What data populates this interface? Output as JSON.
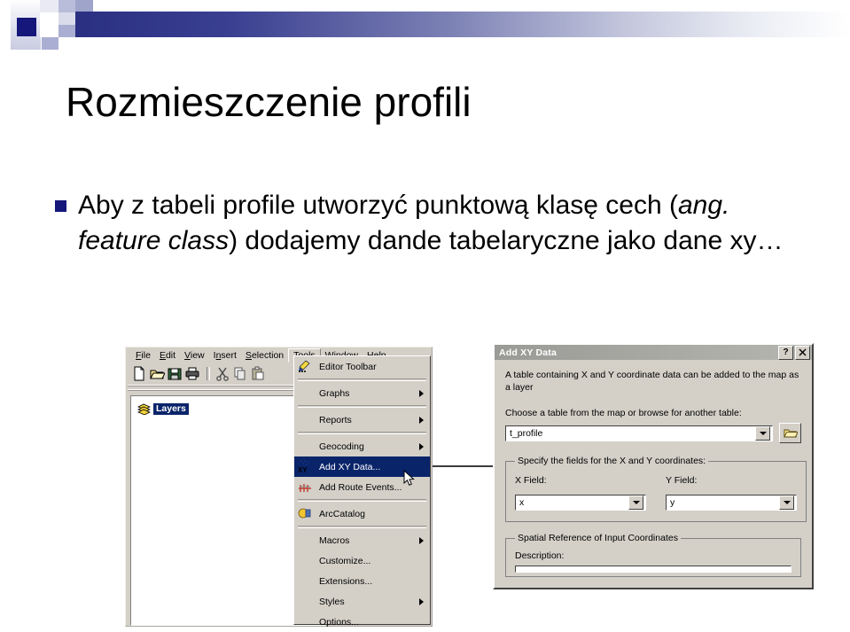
{
  "slide": {
    "title": "Rozmieszczenie profili",
    "bullet": {
      "marker": "square-bullet",
      "line1_a": "Aby z tabeli profile utworzyć punktową klasę cech (",
      "line1_italic": "ang. feature class",
      "line1_b": ") dodajemy dande tabelaryczne jako dane xy…"
    }
  },
  "arcmap": {
    "menubar": [
      {
        "label": "File",
        "accel": "F"
      },
      {
        "label": "Edit",
        "accel": "E"
      },
      {
        "label": "View",
        "accel": "V"
      },
      {
        "label": "Insert",
        "accel": "I"
      },
      {
        "label": "Selection",
        "accel": "S"
      },
      {
        "label": "Tools",
        "accel": "T"
      },
      {
        "label": "Window",
        "accel": "W"
      },
      {
        "label": "Help",
        "accel": "H"
      }
    ],
    "toolbar_icons": [
      "new-document-icon",
      "open-folder-icon",
      "save-icon",
      "print-icon",
      "cut-scissors-icon",
      "copy-icon",
      "paste-icon"
    ],
    "toc": {
      "layers_icon": "layers-stack-icon",
      "layers_label": "Layers"
    },
    "tools_menu": [
      {
        "label": "Editor Toolbar",
        "icon": "editor-toolbar-icon",
        "submenu": false,
        "selected": false
      },
      {
        "label": "Graphs",
        "icon": "",
        "submenu": true,
        "selected": false
      },
      {
        "label": "Reports",
        "icon": "",
        "submenu": true,
        "selected": false
      },
      {
        "label": "Geocoding",
        "icon": "",
        "submenu": true,
        "selected": false
      },
      {
        "label": "Add XY Data...",
        "icon": "add-xy-data-icon",
        "submenu": false,
        "selected": true
      },
      {
        "label": "Add Route Events...",
        "icon": "add-route-events-icon",
        "submenu": false,
        "selected": false
      },
      {
        "label": "ArcCatalog",
        "icon": "arccatalog-icon",
        "submenu": false,
        "selected": false
      },
      {
        "label": "Macros",
        "icon": "",
        "submenu": true,
        "selected": false
      },
      {
        "label": "Customize...",
        "icon": "",
        "submenu": false,
        "selected": false
      },
      {
        "label": "Extensions...",
        "icon": "",
        "submenu": false,
        "selected": false
      },
      {
        "label": "Styles",
        "icon": "",
        "submenu": true,
        "selected": false
      },
      {
        "label": "Options...",
        "icon": "",
        "submenu": false,
        "selected": false
      }
    ],
    "cursor": "mouse-pointer"
  },
  "dialog": {
    "title": "Add XY Data",
    "help_button": "?",
    "close_button": "✕",
    "description": "A table containing X and Y coordinate data can be added to the map as a layer",
    "choose_label": "Choose a table from the map or browse for another table:",
    "table_value": "t_profile",
    "browse_icon": "open-folder-icon",
    "fields_group_legend": "Specify the fields for the X and Y coordinates:",
    "x_field_label": "X Field:",
    "x_field_value": "x",
    "y_field_label": "Y Field:",
    "y_field_value": "y",
    "spatial_group_legend": "Spatial Reference of Input Coordinates",
    "description_label": "Description:"
  },
  "colors": {
    "accent_navy": "#15177a",
    "selection_blue": "#0a246a",
    "window_face": "#d4d0c8",
    "titlebar_gray": "#9a9a96"
  }
}
